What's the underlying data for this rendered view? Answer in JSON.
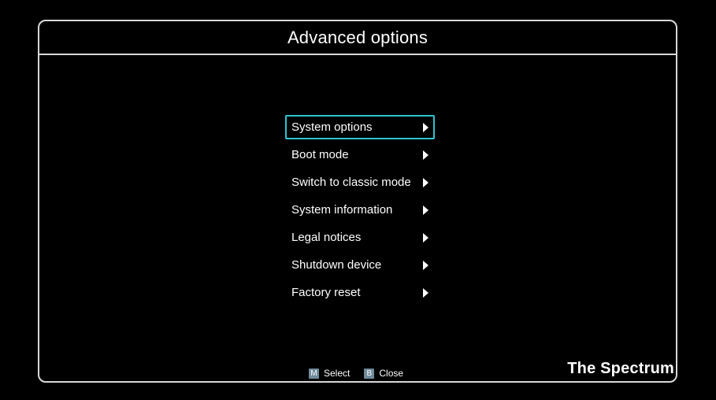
{
  "window": {
    "title": "Advanced options"
  },
  "menu": {
    "items": [
      {
        "label": "System options",
        "selected": true
      },
      {
        "label": "Boot mode",
        "selected": false
      },
      {
        "label": "Switch to classic mode",
        "selected": false
      },
      {
        "label": "System information",
        "selected": false
      },
      {
        "label": "Legal notices",
        "selected": false
      },
      {
        "label": "Shutdown device",
        "selected": false
      },
      {
        "label": "Factory reset",
        "selected": false
      }
    ]
  },
  "footer": {
    "select_key": "M",
    "select_label": "Select",
    "close_key": "B",
    "close_label": "Close"
  },
  "brand": "The Spectrum",
  "colors": {
    "background": "#000000",
    "frame": "#d8d8d8",
    "selection": "#2ec4d0",
    "key_badge": "#6f8a9a"
  }
}
